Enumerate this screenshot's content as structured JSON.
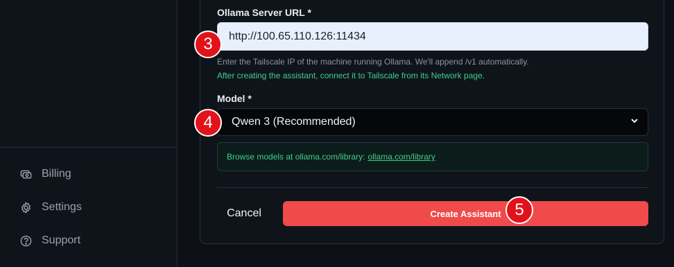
{
  "sidebar": {
    "items": [
      {
        "label": "Billing",
        "icon": "billing-icon"
      },
      {
        "label": "Settings",
        "icon": "gear-icon"
      },
      {
        "label": "Support",
        "icon": "help-icon"
      }
    ]
  },
  "form": {
    "server_url": {
      "label": "Ollama Server URL *",
      "value": "http://100.65.110.126:11434",
      "help": "Enter the Tailscale IP of the machine running Ollama. We'll append /v1 automatically.",
      "note": "After creating the assistant, connect it to Tailscale from its Network page."
    },
    "model": {
      "label": "Model *",
      "selected": "Qwen 3 (Recommended)"
    },
    "info": {
      "text": "Browse models at ollama.com/library:",
      "link": "ollama.com/library"
    },
    "cancel_label": "Cancel",
    "create_label": "Create Assistant"
  },
  "badges": [
    "3",
    "4",
    "5"
  ],
  "colors": {
    "accent_red": "#f04a4a",
    "success_green": "#3fcf8e",
    "badge_red": "#e2121b"
  }
}
